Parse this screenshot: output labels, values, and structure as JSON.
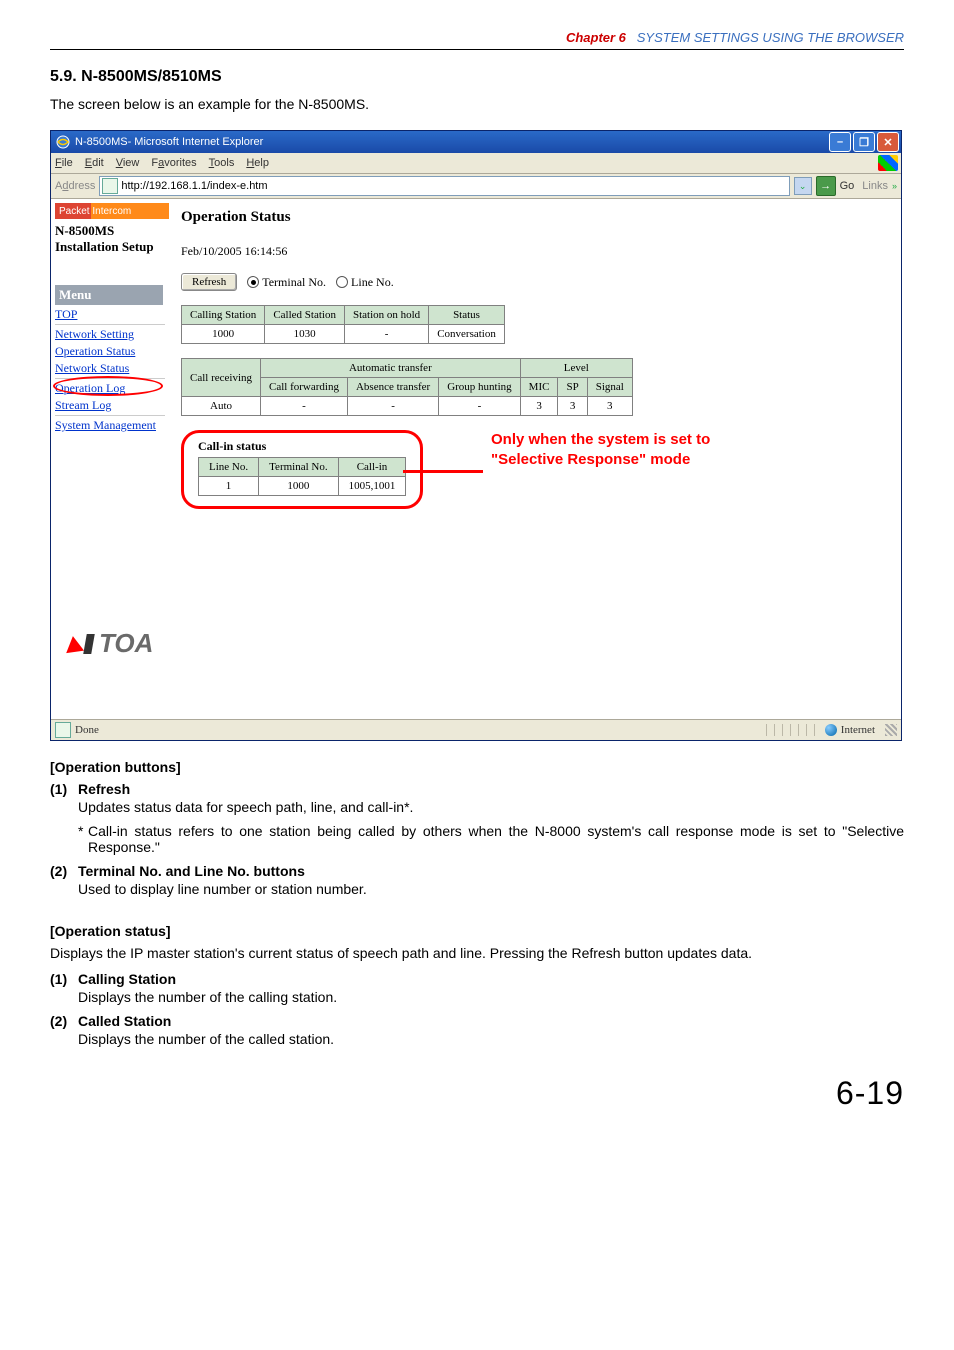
{
  "chapter": {
    "label": "Chapter 6",
    "title": "SYSTEM SETTINGS USING THE BROWSER"
  },
  "section": {
    "number": "5.9.",
    "title": "N-8500MS/8510MS"
  },
  "intro": "The screen below is an example for the N-8500MS.",
  "ie": {
    "title": "N-8500MS- Microsoft Internet Explorer",
    "menu": {
      "file": "File",
      "edit": "Edit",
      "view": "View",
      "favorites": "Favorites",
      "tools": "Tools",
      "help": "Help"
    },
    "addr_label": "Address",
    "addr_value": "http://192.168.1.1/index-e.htm",
    "go": "Go",
    "links": "Links",
    "status_done": "Done",
    "status_zone": "Internet"
  },
  "sidebar": {
    "packet": "Packet Intercom",
    "model": "N-8500MS",
    "install": "Installation Setup",
    "menu_head": "Menu",
    "items": [
      {
        "label": "TOP"
      },
      {
        "label": "Network Setting"
      },
      {
        "label": "Operation Status"
      },
      {
        "label": "Network Status"
      },
      {
        "label": "Operation Log"
      },
      {
        "label": "Stream Log"
      },
      {
        "label": "System Management"
      }
    ],
    "toa": "TOA"
  },
  "main": {
    "title": "Operation Status",
    "date": "Feb/10/2005 16:14:56",
    "refresh": "Refresh",
    "radio_terminal": "Terminal No.",
    "radio_line": "Line No.",
    "table1": {
      "headers": [
        "Calling Station",
        "Called Station",
        "Station on hold",
        "Status"
      ],
      "row": [
        "1000",
        "1030",
        "-",
        "Conversation"
      ]
    },
    "table2": {
      "h_callrecv": "Call receiving",
      "h_auto": "Automatic transfer",
      "h_level": "Level",
      "sub": [
        "Call forwarding",
        "Absence transfer",
        "Group hunting",
        "MIC",
        "SP",
        "Signal"
      ],
      "row_label": "Auto",
      "row": [
        "-",
        "-",
        "-",
        "3",
        "3",
        "3"
      ]
    },
    "callin": {
      "title": "Call-in status",
      "headers": [
        "Line No.",
        "Terminal No.",
        "Call-in"
      ],
      "row": [
        "1",
        "1000",
        "1005,1001"
      ]
    },
    "annot_line1": "Only when the system is set to",
    "annot_line2": "\"Selective Response\" mode"
  },
  "op_buttons": {
    "header": "[Operation buttons]",
    "items": [
      {
        "n": "(1)",
        "t": "Refresh",
        "d": "Updates status data for speech path, line, and call-in*.",
        "note": "Call-in status refers to one station being called by others when the N-8000 system's call response mode is set to \"Selective Response.\""
      },
      {
        "n": "(2)",
        "t": "Terminal No. and Line No. buttons",
        "d": "Used to display line number or station number."
      }
    ]
  },
  "op_status": {
    "header": "[Operation status]",
    "intro": "Displays the IP master station's current status of speech path and line. Pressing the Refresh button updates data.",
    "items": [
      {
        "n": "(1)",
        "t": "Calling Station",
        "d": "Displays the number of the calling station."
      },
      {
        "n": "(2)",
        "t": "Called Station",
        "d": "Displays the number of the called station."
      }
    ]
  },
  "page_number": "6-19"
}
